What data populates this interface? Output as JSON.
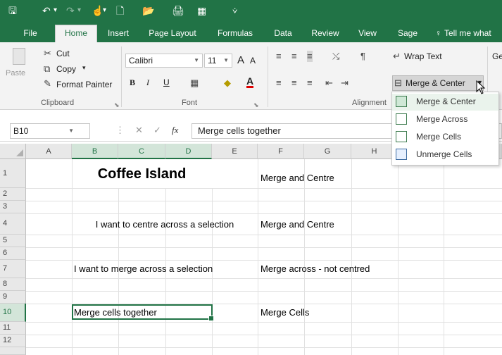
{
  "qat": {
    "save": "🖫",
    "undo": "↶",
    "undo_dd": "▾",
    "redo": "↷",
    "redo_dd": "▾",
    "touch": "☝",
    "touch_dd": "▾",
    "new": "🗋",
    "open": "📂",
    "print": "🖨",
    "form": "▦",
    "customize": "⩒"
  },
  "tabs": [
    "File",
    "Home",
    "Insert",
    "Page Layout",
    "Formulas",
    "Data",
    "Review",
    "View",
    "Sage",
    "Tell me what"
  ],
  "ribbon": {
    "paste": "Paste",
    "cut": "Cut",
    "copy": "Copy",
    "copy_dd": "▾",
    "format_painter": "Format Painter",
    "clipboard": "Clipboard",
    "font_name": "Calibri",
    "font_size": "11",
    "grow": "A",
    "shrink": "A",
    "bold": "B",
    "italic": "I",
    "underline": "U",
    "font_group": "Font",
    "wrap_text": "Wrap Text",
    "merge_center": "Merge & Center",
    "alignment_group": "Alignment",
    "general": "Ge"
  },
  "menu": {
    "items": [
      "Merge & Center",
      "Merge Across",
      "Merge Cells",
      "Unmerge Cells"
    ]
  },
  "formula_bar": {
    "name_box": "B10",
    "cancel": "✕",
    "enter": "✓",
    "fx": "fx",
    "formula": "Merge cells together"
  },
  "columns": [
    "A",
    "B",
    "C",
    "D",
    "E",
    "F",
    "G",
    "H"
  ],
  "rows": [
    "1",
    "2",
    "3",
    "4",
    "5",
    "6",
    "7",
    "8",
    "9",
    "10",
    "11",
    "12"
  ],
  "cells": {
    "title": "Coffee Island",
    "f1": "Merge and Centre",
    "b4": "I want to centre across a selection",
    "f4": "Merge and Centre",
    "b7": "I want to merge across a selection",
    "f7": "Merge across - not centred",
    "b10": "Merge cells together",
    "f10": "Merge Cells"
  },
  "colors": {
    "accent": "#217346",
    "ribbon": "#f3f3f3",
    "header": "#e8e8e8"
  }
}
